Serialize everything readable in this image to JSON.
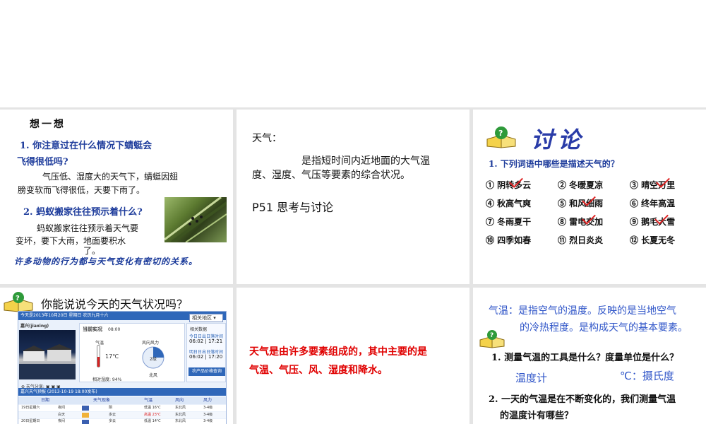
{
  "slide1": {
    "title": "想一想",
    "q1_line1": "1. 你注意过在什么情况下蜻蜓会",
    "q1_line2": "飞得很低吗?",
    "a1_line1": "气压低、湿度大的天气下，蜻蜓因翅",
    "a1_line2": "膀变软而飞得很低，天要下雨了。",
    "q2": "2. 蚂蚁搬家往往预示着什么?",
    "a2_line1": "蚂蚁搬家往往预示着天气要",
    "a2_line2": "变坏，要下大雨，地面要积水",
    "a2_line3": "了。",
    "footer": "许多动物的行为都与天气变化有密切的关系。"
  },
  "slide2": {
    "label": "天气：",
    "def_line1": "是指短时间内近地面的大气温",
    "def_line2": "度、湿度、气压等要素的综合状况。",
    "ref": "P51  思考与讨论"
  },
  "slide3": {
    "title": "讨论",
    "question": "1. 下列词语中哪些是描述天气的？",
    "terms": [
      "① 阴转多云",
      "② 冬暖夏凉",
      "③ 晴空万里",
      "④ 秋高气爽",
      "⑤ 和风细雨",
      "⑥ 终年高温",
      "⑦ 冬雨夏干",
      "⑧ 雷电交加",
      "⑨ 鹅毛大雪",
      "⑩ 四季如春",
      "⑪ 烈日炎炎",
      "⑫ 长夏无冬"
    ]
  },
  "slide4": {
    "question": "你能说说今天的天气状况吗？",
    "widget": {
      "date_bar": "今天是2013年10月20日 星期日 农历九月十六",
      "region_select": "相关地区",
      "city": "嘉兴(jiaxing)",
      "now_label": "当前实况",
      "now_time": "08:00",
      "temp_label": "气温",
      "temp_value": "17℃",
      "wind_label": "风向风力",
      "wind_value": "2级",
      "wind_dir": "北风",
      "humidity": "相对湿度: 94%",
      "sun_title": "相关数据",
      "sun_label1": "今日日出日落时间",
      "sun_time1": "06:02 | 17:21",
      "sun_label2": "明日日出日落时间",
      "sun_time2": "06:02 | 17:20",
      "query_btn": "农产品价格查询",
      "forecast_title": "嘉兴天气预报 (2013-10-19 18:00发布)",
      "cols": [
        "日期",
        "天气现象",
        "气温",
        "风向",
        "风力"
      ],
      "rows": [
        [
          "19日星期六",
          "夜间",
          "阴",
          "低温 16℃",
          "东北风",
          "3-4级"
        ],
        [
          "",
          "白天",
          "多云",
          "高温 23℃",
          "东北风",
          "3-4级"
        ],
        [
          "20日星期日",
          "夜间",
          "多云",
          "低温 14℃",
          "东北风",
          "3-4级"
        ]
      ]
    }
  },
  "slide5": {
    "line1": "天气是由许多要素组成的，其中主要的是",
    "line2": "气温、气压、风、湿度和降水。"
  },
  "slide6": {
    "def_line1": "气温：是指空气的温度。反映的是当地空气",
    "def_line2": "的冷热程度。是构成天气的基本要素。",
    "q1": "1. 测量气温的工具是什么？度量单位是什么？",
    "a1_tool": "温度计",
    "a1_unit": "℃：摄氏度",
    "q2_line1": "2. 一天的气温是在不断变化的，我们测量气温",
    "q2_line2": "的温度计有哪些？"
  },
  "colors": {
    "navy": "#1f3d9c",
    "red": "#e00000",
    "blue_answer": "#2f55c8",
    "separator": "#e4e4e4"
  }
}
